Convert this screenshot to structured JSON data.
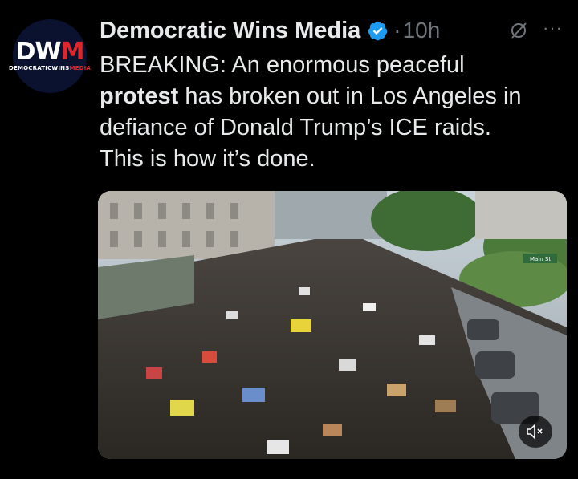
{
  "account": {
    "avatar_logo": "DWM",
    "avatar_sub_left": "DEMOCRATICWINS",
    "avatar_sub_right": "MEDIA",
    "name": "Democratic Wins Media",
    "verified_icon": "verified-badge-icon",
    "separator": "·",
    "time": "10h"
  },
  "actions": {
    "grok_icon": "grok-icon",
    "more_label": "···"
  },
  "tweet": {
    "line1_a": "BREAKING: An enormous peaceful",
    "line2_bold": "protest",
    "line2_rest": " has broken out in Los Angeles in",
    "line3": "defiance of Donald Trump’s ICE raids.",
    "line4": "This is how it’s done."
  },
  "media": {
    "street_sign": "Main St",
    "mute_icon": "mute-icon"
  },
  "colors": {
    "background": "#000000",
    "text": "#e7e9ea",
    "muted": "#71767b",
    "verified": "#1d9bf0",
    "brand_red": "#e0252b"
  }
}
